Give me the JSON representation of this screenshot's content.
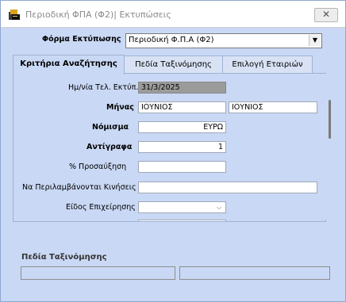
{
  "window": {
    "title": "Περιοδική ΦΠΑ (Φ2)| Εκτυπώσεις",
    "close_glyph": "✕"
  },
  "print_form": {
    "label": "Φόρμα Εκτύπωσης",
    "value": "Περιοδική Φ.Π.Α (Φ2)",
    "arrow": "▼"
  },
  "tabs": [
    {
      "label": "Κριτήρια Αναζήτησης",
      "active": true
    },
    {
      "label": "Πεδία Ταξινόμησης",
      "active": false
    },
    {
      "label": "Επιλογή Εταιριών",
      "active": false
    }
  ],
  "criteria": {
    "print_date": {
      "label": "Ημ/νία Τελ. Εκτύπ.",
      "value": "31/3/2025"
    },
    "month": {
      "label": "Μήνας",
      "from": "ΙΟΥΝΙΟΣ",
      "to": "ΙΟΥΝΙΟΣ"
    },
    "currency": {
      "label": "Νόμισμα",
      "value": "ΕΥΡΩ"
    },
    "copies": {
      "label": "Αντίγραφα",
      "value": "1"
    },
    "surcharge": {
      "label": "% Προσαύξηση",
      "value": ""
    },
    "include_moves": {
      "label": "Να Περιλαμβάνονται Κινήσεις",
      "value": ""
    },
    "business_type": {
      "label": "Είδος Επιχείρησης",
      "value": "",
      "arrow": "⌵"
    }
  },
  "sort_fields": {
    "label": "Πεδία Ταξινόμησης"
  },
  "colors": {
    "window_bg": "#c9d8f4",
    "readonly_field": "#9b9b9b"
  }
}
